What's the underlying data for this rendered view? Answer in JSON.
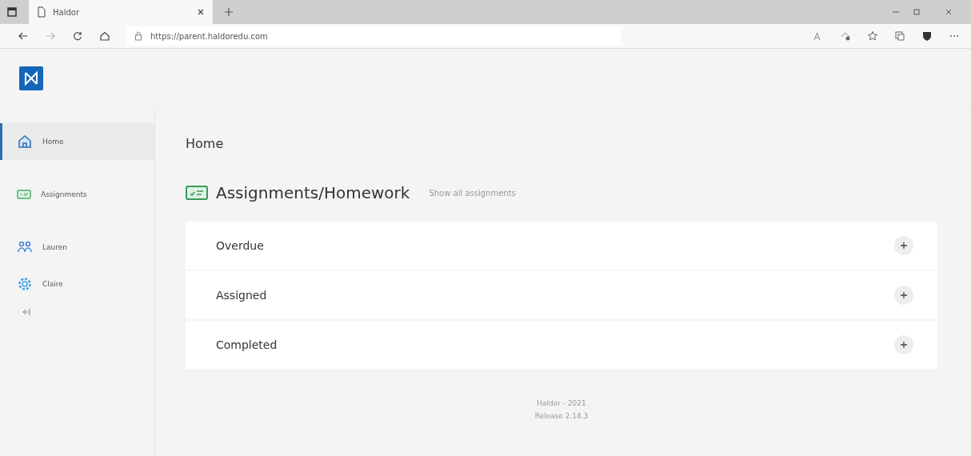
{
  "browser": {
    "tab_title": "Haldor",
    "url": "https://parent.haldoredu.com"
  },
  "sidebar": {
    "items": [
      {
        "label": "Home",
        "kind": "home",
        "selected": true
      },
      {
        "label": "Assignments",
        "kind": "assignments",
        "selected": false
      },
      {
        "label": "Lauren",
        "kind": "group",
        "selected": false
      },
      {
        "label": "Claire",
        "kind": "gear",
        "selected": false
      }
    ]
  },
  "page_title": "Home",
  "section": {
    "title": "Assignments/Homework",
    "link": "Show all assignments"
  },
  "groups": [
    {
      "label": "Overdue",
      "expanded": false
    },
    {
      "label": "Assigned",
      "expanded": false
    },
    {
      "label": "Completed",
      "expanded": false
    }
  ],
  "footer": [
    "Haldor - 2021",
    "Release 2.14.3"
  ]
}
